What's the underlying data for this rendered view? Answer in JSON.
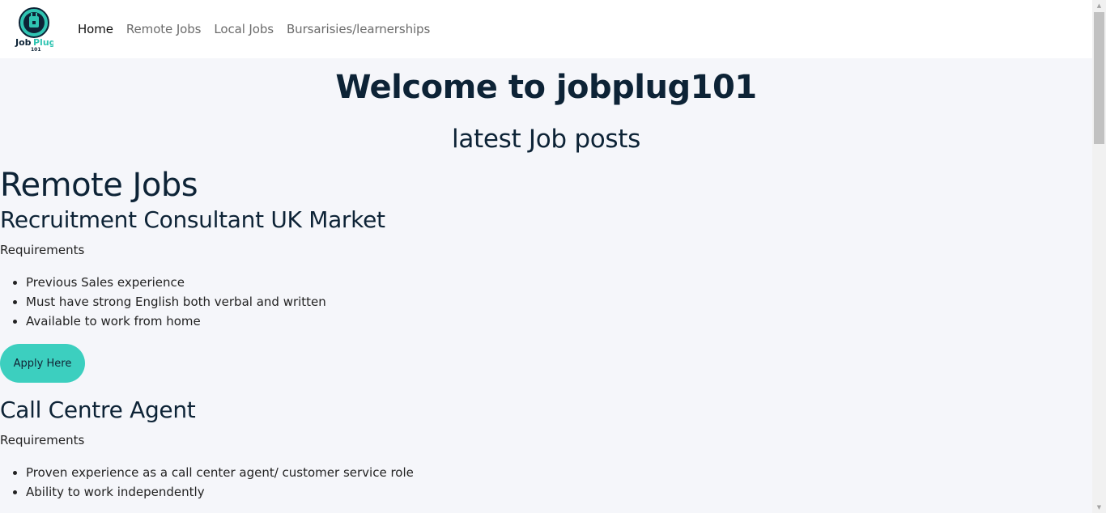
{
  "navbar": {
    "logo_text": "JobPlug 101",
    "links": [
      {
        "label": "Home"
      },
      {
        "label": "Remote Jobs"
      },
      {
        "label": "Local Jobs"
      },
      {
        "label": "Bursarisies/learnerships"
      }
    ]
  },
  "main": {
    "welcome_title": "Welcome to jobplug101",
    "latest_heading": "latest Job posts",
    "section_title": "Remote Jobs",
    "jobs": [
      {
        "title": "Recruitment Consultant UK Market",
        "requirements_label": "Requirements",
        "requirements": [
          "Previous Sales experience",
          "Must have strong English both verbal and written",
          "Available to work from home"
        ],
        "apply_label": "Apply Here"
      },
      {
        "title": "Call Centre Agent",
        "requirements_label": "Requirements",
        "requirements": [
          "Proven experience as a call center agent/ customer service role",
          "Ability to work independently"
        ]
      }
    ]
  },
  "colors": {
    "accent": "#3ccfbf",
    "heading": "#0d2336",
    "background": "#f5f6fa"
  }
}
